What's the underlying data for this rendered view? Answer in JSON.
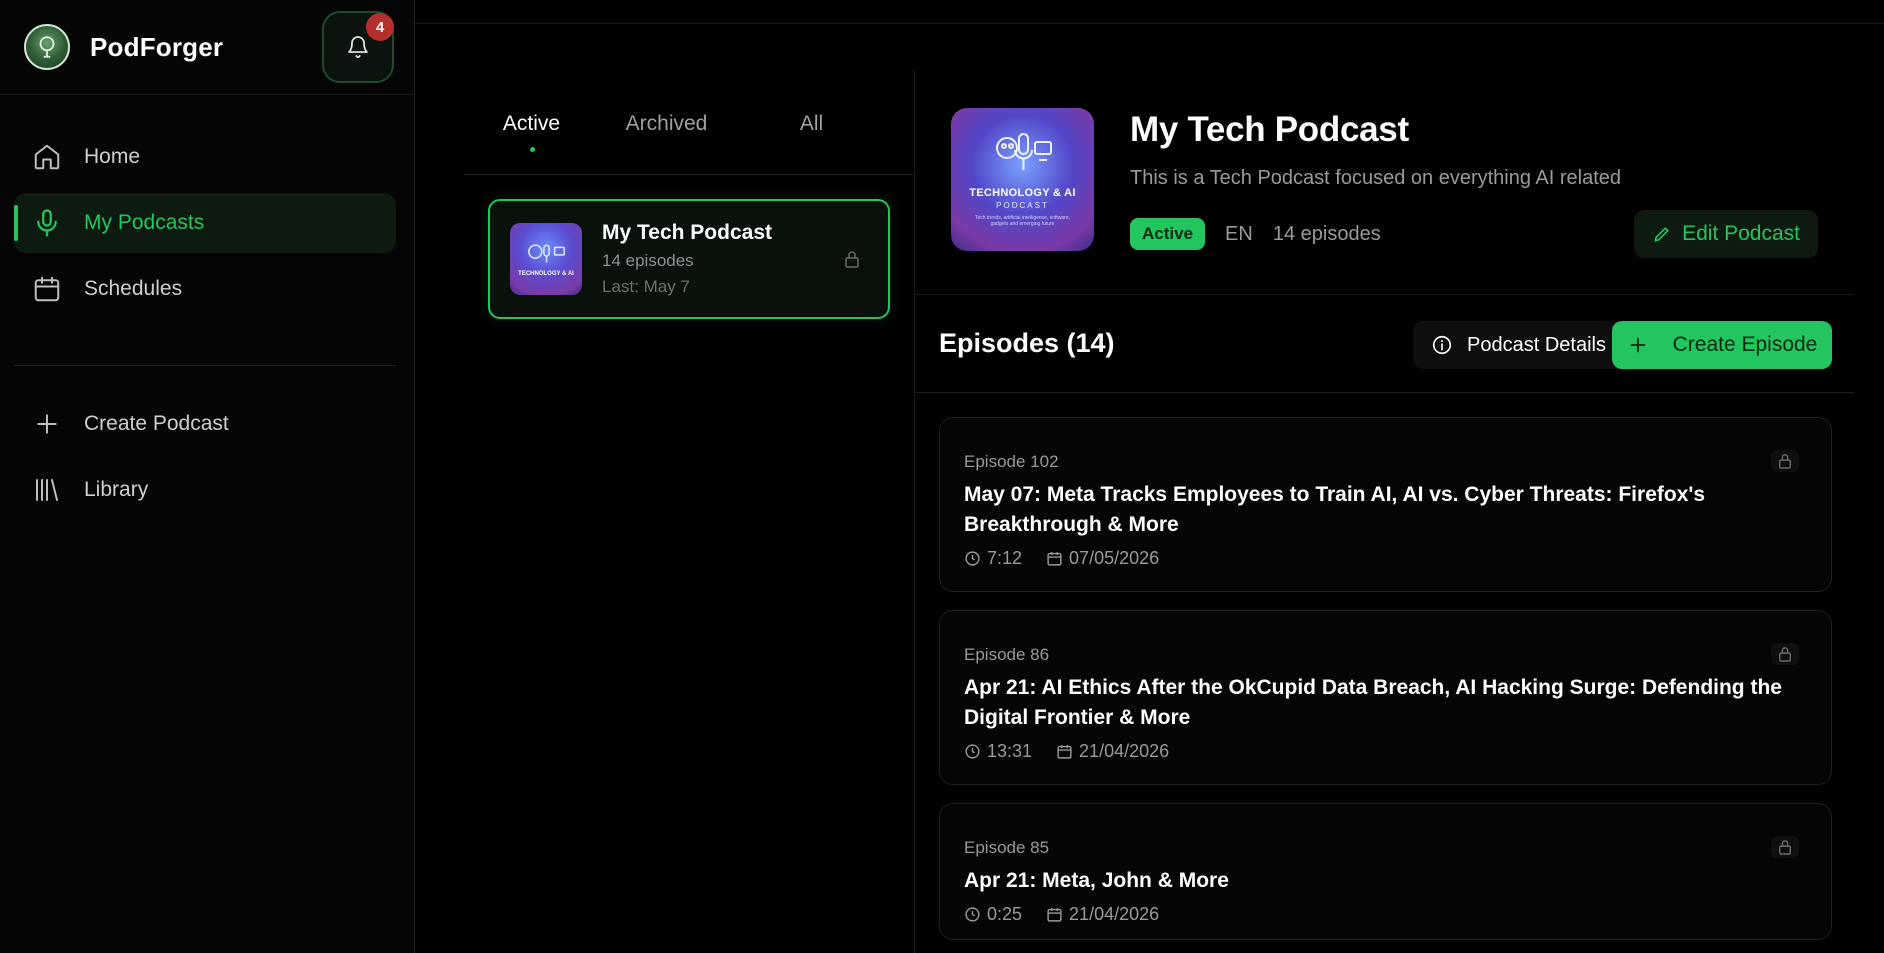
{
  "app": {
    "name": "PodForger",
    "notification_count": "4"
  },
  "sidebar": {
    "items": [
      {
        "label": "Home"
      },
      {
        "label": "My Podcasts"
      },
      {
        "label": "Schedules"
      },
      {
        "label": "Create Podcast"
      },
      {
        "label": "Library"
      }
    ]
  },
  "tabs": {
    "active": "Active",
    "archived": "Archived",
    "all": "All"
  },
  "podcast_card": {
    "title": "My Tech Podcast",
    "episodes": "14 episodes",
    "last": "Last: May 7",
    "thumb_text": "TECHNOLOGY & AI"
  },
  "podcast": {
    "title": "My Tech Podcast",
    "description": "This is a Tech Podcast focused on everything AI related",
    "status": "Active",
    "language": "EN",
    "episode_count": "14 episodes",
    "edit_label": "Edit Podcast",
    "cover_title": "TECHNOLOGY & AI",
    "cover_sub": "PODCAST",
    "cover_tiny": "Tech trends, artificial intelligence, software, gadgets and emerging future"
  },
  "episodes_header": {
    "title": "Episodes (14)",
    "details_label": "Podcast Details",
    "create_label": "Create Episode"
  },
  "episodes": [
    {
      "number": "Episode 102",
      "title": "May 07: Meta Tracks Employees to Train AI, AI vs. Cyber Threats: Firefox's Breakthrough & More",
      "duration": "7:12",
      "date": "07/05/2026"
    },
    {
      "number": "Episode 86",
      "title": "Apr 21: AI Ethics After the OkCupid Data Breach, AI Hacking Surge: Defending the Digital Frontier & More",
      "duration": "13:31",
      "date": "21/04/2026"
    },
    {
      "number": "Episode 85",
      "title": "Apr 21: Meta, John & More",
      "duration": "0:25",
      "date": "21/04/2026"
    }
  ],
  "colors": {
    "accent": "#22c55e",
    "badge": "#b3302d",
    "background": "#000000"
  }
}
